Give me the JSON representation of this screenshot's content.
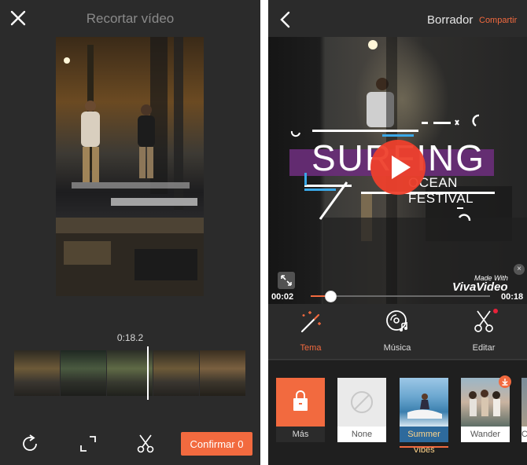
{
  "left_screen": {
    "title": "Recortar vídeo",
    "timecode": "0:18.2",
    "confirm_label": "Confirmar 0",
    "timeline_thumb_count": 5,
    "accent_color": "#f26a3f"
  },
  "right_screen": {
    "title": "Borrador",
    "share_label": "Compartir",
    "overlay": {
      "headline": "SURFING",
      "subline": "OCEAN FESTIVAL"
    },
    "watermark": {
      "made_with": "Made With",
      "brand": "VivaVideo"
    },
    "playback": {
      "current_time": "00:02",
      "total_time": "00:18",
      "progress": 0.11
    },
    "tools": [
      {
        "label": "Tema",
        "icon": "magic-wand-icon",
        "active": true
      },
      {
        "label": "Música",
        "icon": "music-disc-icon",
        "active": false
      },
      {
        "label": "Editar",
        "icon": "scissors-icon",
        "active": false,
        "has_notification": true
      }
    ],
    "themes": [
      {
        "label": "Más",
        "icon": "bag-icon"
      },
      {
        "label": "None",
        "icon": "none-icon"
      },
      {
        "label": "Summer Vibes",
        "selected": true
      },
      {
        "label": "Wander",
        "downloadable": true
      },
      {
        "label": "Ca"
      }
    ],
    "accent_color": "#f26a3f"
  }
}
